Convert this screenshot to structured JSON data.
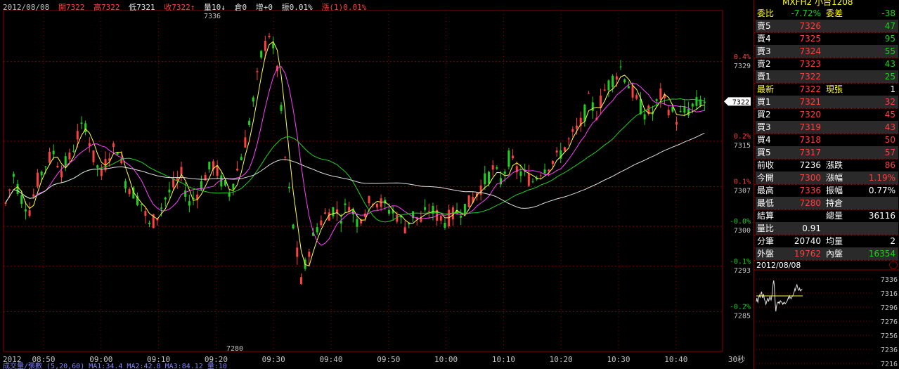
{
  "header": {
    "date": "2012/08/08",
    "open": "開7322",
    "high": "高7322",
    "low": "低7321",
    "close": "收7322↑",
    "vol": "量10↓",
    "oi": "倉0",
    "chg": "增+0",
    "amp": "振0.01%",
    "pct": "漲(1)0.01%"
  },
  "colors": {
    "up": "#ff4040",
    "down": "#20d020",
    "ma1": "#ffff40",
    "ma2": "#ff40ff",
    "ma3": "#20d020",
    "ma4": "#e0e0e0",
    "accent": "#ffff00",
    "grid": "#8a0000"
  },
  "side": {
    "title": "MXFH2 小台1208",
    "rows": [
      {
        "l": "委比",
        "v": "-7.72%",
        "l2": "委差",
        "v2": "-38",
        "lc": "#ffff00",
        "vc": "#20d020",
        "v2c": "#20d020"
      },
      {
        "l": "賣5",
        "v": "7326",
        "v2": "47",
        "vc": "#ff4040",
        "v2c": "#20d020",
        "bg": "grey"
      },
      {
        "l": "賣4",
        "v": "7325",
        "v2": "95",
        "vc": "#ff4040",
        "v2c": "#20d020"
      },
      {
        "l": "賣3",
        "v": "7324",
        "v2": "55",
        "vc": "#ff4040",
        "v2c": "#20d020",
        "bg": "grey"
      },
      {
        "l": "賣2",
        "v": "7323",
        "v2": "43",
        "vc": "#ff4040",
        "v2c": "#20d020"
      },
      {
        "l": "賣1",
        "v": "7322",
        "v2": "25",
        "vc": "#ff4040",
        "v2c": "#20d020",
        "bg": "grey"
      },
      {
        "l": "最新",
        "v": "7322",
        "l2": "現張",
        "v2": "1",
        "lc": "#ffff00",
        "vc": "#ff4040",
        "v2c": "#ffffff"
      },
      {
        "l": "買1",
        "v": "7321",
        "v2": "32",
        "vc": "#ff4040",
        "v2c": "#ff4040",
        "bg": "grey"
      },
      {
        "l": "買2",
        "v": "7320",
        "v2": "45",
        "vc": "#ff4040",
        "v2c": "#ff4040"
      },
      {
        "l": "買3",
        "v": "7319",
        "v2": "43",
        "vc": "#ff4040",
        "v2c": "#ff4040",
        "bg": "grey"
      },
      {
        "l": "買4",
        "v": "7318",
        "v2": "50",
        "vc": "#ff4040",
        "v2c": "#ff4040"
      },
      {
        "l": "買5",
        "v": "7317",
        "v2": "57",
        "vc": "#ff4040",
        "v2c": "#ff4040",
        "bg": "grey"
      },
      {
        "l": "前收",
        "v": "7236",
        "l2": "漲跌",
        "v2": "86",
        "vc": "#ffffff",
        "v2c": "#ff4040"
      },
      {
        "l": "今開",
        "v": "7300",
        "l2": "漲幅",
        "v2": "1.19%",
        "vc": "#ff4040",
        "v2c": "#ff4040",
        "bg": "grey"
      },
      {
        "l": "最高",
        "v": "7336",
        "l2": "振幅",
        "v2": "0.77%",
        "vc": "#ff4040",
        "v2c": "#ffffff"
      },
      {
        "l": "最低",
        "v": "7280",
        "l2": "持倉",
        "v2": "",
        "vc": "#ff4040",
        "v2c": "#ffffff",
        "bg": "grey"
      },
      {
        "l": "結算",
        "v": "",
        "l2": "總量",
        "v2": "36116",
        "vc": "#ffffff",
        "v2c": "#ffffff"
      },
      {
        "l": "量比",
        "v": "0.91",
        "l2": "",
        "v2": "",
        "vc": "#ffffff",
        "v2c": "#ffffff",
        "bg": "grey"
      },
      {
        "l": "分筆",
        "v": "20740",
        "l2": "均量",
        "v2": "2",
        "vc": "#ffffff",
        "v2c": "#ffffff"
      },
      {
        "l": "外盤",
        "v": "19762",
        "l2": "內盤",
        "v2": "16354",
        "vc": "#ff4040",
        "v2c": "#20d020",
        "bg": "grey"
      }
    ],
    "mini_date": "2012/08/08",
    "mini_ticks": [
      "7336",
      "7316",
      "7296",
      "7276",
      "7256",
      "7236",
      "7216"
    ]
  },
  "chart_data": {
    "type": "candlestick",
    "y_ticks": [
      {
        "price": 7329,
        "pct": "0.4%"
      },
      {
        "price": 7315,
        "pct": "0.2%"
      },
      {
        "price": 7307,
        "pct": "0.1%"
      },
      {
        "price": 7300,
        "pct": "-0.0%"
      },
      {
        "price": 7293,
        "pct": "-0.1%"
      },
      {
        "price": 7285,
        "pct": "-0.2%"
      }
    ],
    "x_labels": [
      "2012",
      "08:50",
      "09:00",
      "09:10",
      "09:20",
      "09:30",
      "09:40",
      "09:50",
      "10:00",
      "10:10",
      "10:20",
      "10:30",
      "10:40",
      "30秒"
    ],
    "high_label": "7336",
    "low_label": "7280",
    "last_price": "7322",
    "bottom_text": "成交量/張數 (5,20,60) MA1:34.4 MA2:42.8 MA3:84.12 量:10",
    "ylim": [
      7278,
      7338
    ],
    "close_path": [
      7304,
      7309,
      7305,
      7303,
      7308,
      7311,
      7313,
      7310,
      7312,
      7316,
      7318,
      7312,
      7309,
      7313,
      7314,
      7308,
      7306,
      7304,
      7300,
      7302,
      7305,
      7307,
      7309,
      7304,
      7306,
      7309,
      7311,
      7308,
      7306,
      7310,
      7315,
      7322,
      7330,
      7334,
      7328,
      7312,
      7300,
      7290,
      7296,
      7300,
      7302,
      7303,
      7302,
      7304,
      7301,
      7303,
      7305,
      7304,
      7303,
      7302,
      7300,
      7302,
      7301,
      7303,
      7302,
      7301,
      7302,
      7303,
      7304,
      7306,
      7308,
      7310,
      7308,
      7312,
      7310,
      7309,
      7308,
      7310,
      7311,
      7312,
      7314,
      7316,
      7318,
      7322,
      7320,
      7324,
      7326,
      7328,
      7325,
      7322,
      7320,
      7320,
      7323,
      7321,
      7319,
      7320,
      7321,
      7322
    ],
    "ma_levels": {
      "ma1": "ma of close 3",
      "ma2": "ma of close 8",
      "ma3": "ma of close 20"
    }
  }
}
